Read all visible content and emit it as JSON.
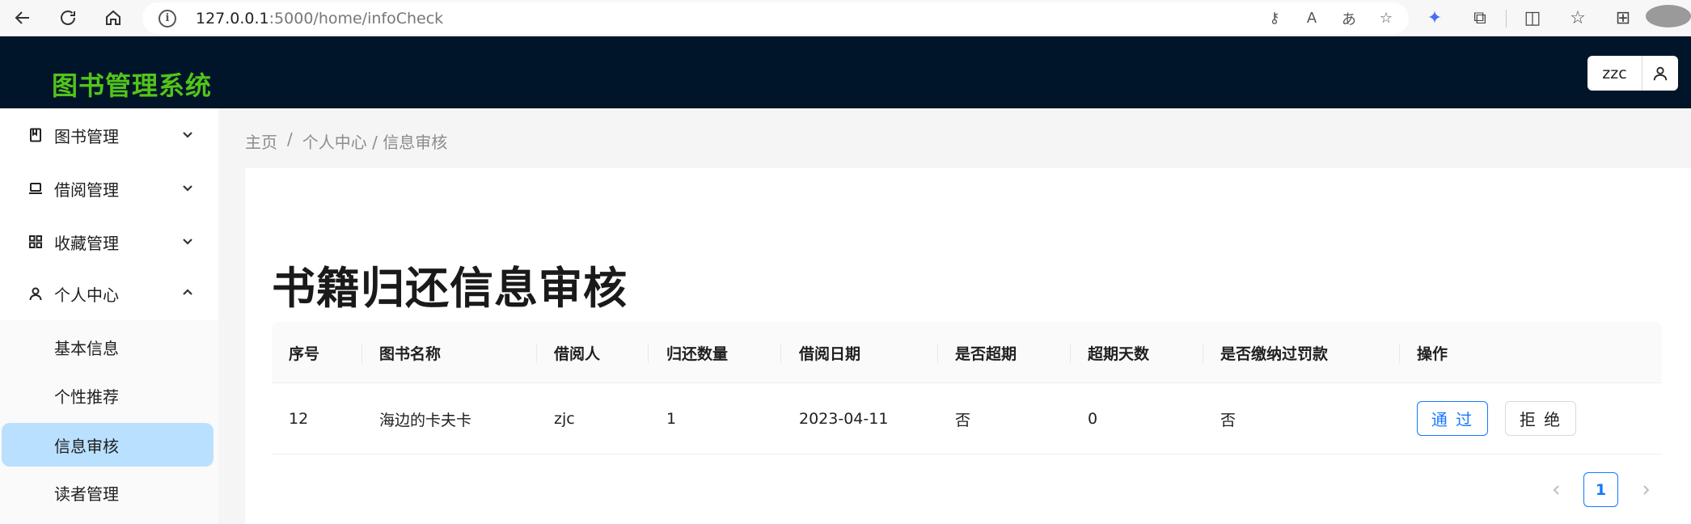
{
  "browser": {
    "url_host": "127.0.0.1",
    "url_rest": ":5000/home/infoCheck"
  },
  "header": {
    "app_title": "图书管理系统",
    "username": "zzc"
  },
  "sidebar": {
    "items": [
      {
        "label": "图书管理",
        "icon": "book-icon",
        "expanded": false
      },
      {
        "label": "借阅管理",
        "icon": "laptop-icon",
        "expanded": false
      },
      {
        "label": "收藏管理",
        "icon": "appstore-icon",
        "expanded": false
      },
      {
        "label": "个人中心",
        "icon": "user-icon",
        "expanded": true
      }
    ],
    "subitems": [
      {
        "label": "基本信息",
        "active": false
      },
      {
        "label": "个性推荐",
        "active": false
      },
      {
        "label": "信息审核",
        "active": true
      },
      {
        "label": "读者管理",
        "active": false
      }
    ]
  },
  "breadcrumb": {
    "home": "主页",
    "separator": "/",
    "path": "个人中心 / 信息审核"
  },
  "page": {
    "title": "书籍归还信息审核"
  },
  "table": {
    "columns": [
      "序号",
      "图书名称",
      "借阅人",
      "归还数量",
      "借阅日期",
      "是否超期",
      "超期天数",
      "是否缴纳过罚款",
      "操作"
    ],
    "rows": [
      {
        "id": "12",
        "book_name": "海边的卡夫卡",
        "borrower": "zjc",
        "return_count": "1",
        "borrow_date": "2023-04-11",
        "overdue": "否",
        "overdue_days": "0",
        "fine_paid": "否",
        "actions": {
          "pass": "通 过",
          "reject": "拒 绝"
        }
      }
    ]
  },
  "pagination": {
    "current_page": "1"
  },
  "colors": {
    "header_bg": "#001529",
    "title_green": "#52c41a",
    "primary_blue": "#1677ff",
    "active_menu_bg": "#bae0ff"
  }
}
